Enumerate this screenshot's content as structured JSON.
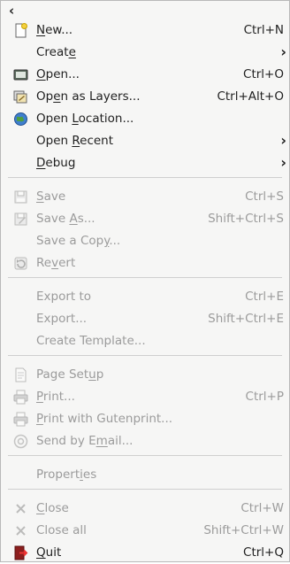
{
  "menu": {
    "back_glyph": "‹",
    "groups": [
      [
        {
          "name": "new",
          "pre": "",
          "mn": "N",
          "post": "ew...",
          "acc": "Ctrl+N",
          "icon": "new-file-icon",
          "enabled": true,
          "arrow": false
        },
        {
          "name": "create",
          "pre": "Creat",
          "mn": "e",
          "post": "",
          "acc": "",
          "icon": "",
          "enabled": true,
          "arrow": true
        },
        {
          "name": "open",
          "pre": "",
          "mn": "O",
          "post": "pen...",
          "acc": "Ctrl+O",
          "icon": "open-folder-icon",
          "enabled": true,
          "arrow": false
        },
        {
          "name": "open-as-layers",
          "pre": "Op",
          "mn": "e",
          "post": "n as Layers...",
          "acc": "Ctrl+Alt+O",
          "icon": "layers-icon",
          "enabled": true,
          "arrow": false
        },
        {
          "name": "open-location",
          "pre": "Open ",
          "mn": "L",
          "post": "ocation...",
          "acc": "",
          "icon": "globe-icon",
          "enabled": true,
          "arrow": false
        },
        {
          "name": "open-recent",
          "pre": "Open ",
          "mn": "R",
          "post": "ecent",
          "acc": "",
          "icon": "",
          "enabled": true,
          "arrow": true
        },
        {
          "name": "debug",
          "pre": "",
          "mn": "D",
          "post": "ebug",
          "acc": "",
          "icon": "",
          "enabled": true,
          "arrow": true
        }
      ],
      [
        {
          "name": "save",
          "pre": "",
          "mn": "S",
          "post": "ave",
          "acc": "Ctrl+S",
          "icon": "save-icon",
          "enabled": false,
          "arrow": false
        },
        {
          "name": "save-as",
          "pre": "Save ",
          "mn": "A",
          "post": "s...",
          "acc": "Shift+Ctrl+S",
          "icon": "save-as-icon",
          "enabled": false,
          "arrow": false
        },
        {
          "name": "save-a-copy",
          "pre": "Save a Cop",
          "mn": "y",
          "post": "...",
          "acc": "",
          "icon": "",
          "enabled": false,
          "arrow": false
        },
        {
          "name": "revert",
          "pre": "Re",
          "mn": "v",
          "post": "ert",
          "acc": "",
          "icon": "revert-icon",
          "enabled": false,
          "arrow": false
        }
      ],
      [
        {
          "name": "export-to",
          "pre": "Export to",
          "mn": "",
          "post": "",
          "acc": "Ctrl+E",
          "icon": "",
          "enabled": false,
          "arrow": false
        },
        {
          "name": "export",
          "pre": "Export...",
          "mn": "",
          "post": "",
          "acc": "Shift+Ctrl+E",
          "icon": "",
          "enabled": false,
          "arrow": false
        },
        {
          "name": "create-template",
          "pre": "Create Template...",
          "mn": "",
          "post": "",
          "acc": "",
          "icon": "",
          "enabled": false,
          "arrow": false
        }
      ],
      [
        {
          "name": "page-setup",
          "pre": "Page Set",
          "mn": "u",
          "post": "p",
          "acc": "",
          "icon": "page-setup-icon",
          "enabled": false,
          "arrow": false
        },
        {
          "name": "print",
          "pre": "",
          "mn": "P",
          "post": "rint...",
          "acc": "Ctrl+P",
          "icon": "printer-icon",
          "enabled": false,
          "arrow": false
        },
        {
          "name": "print-with-gutenprint",
          "pre": "",
          "mn": "P",
          "post": "rint with Gutenprint...",
          "acc": "",
          "icon": "printer-icon",
          "enabled": false,
          "arrow": false
        },
        {
          "name": "send-by-email",
          "pre": "Send by E",
          "mn": "m",
          "post": "ail...",
          "acc": "",
          "icon": "email-icon",
          "enabled": false,
          "arrow": false
        }
      ],
      [
        {
          "name": "properties",
          "pre": "Propert",
          "mn": "i",
          "post": "es",
          "acc": "",
          "icon": "",
          "enabled": false,
          "arrow": false
        }
      ],
      [
        {
          "name": "close",
          "pre": "",
          "mn": "C",
          "post": "lose",
          "acc": "Ctrl+W",
          "icon": "close-icon",
          "enabled": false,
          "arrow": false
        },
        {
          "name": "close-all",
          "pre": "Close all",
          "mn": "",
          "post": "",
          "acc": "Shift+Ctrl+W",
          "icon": "close-icon",
          "enabled": false,
          "arrow": false
        },
        {
          "name": "quit",
          "pre": "",
          "mn": "Q",
          "post": "uit",
          "acc": "Ctrl+Q",
          "icon": "quit-icon",
          "enabled": true,
          "arrow": false
        }
      ]
    ]
  }
}
